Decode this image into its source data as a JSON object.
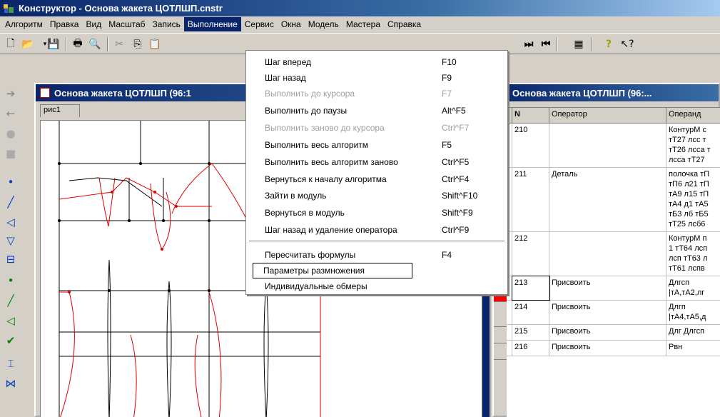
{
  "window": {
    "title": "Конструктор - Основа жакета ЦОТЛШП.cnstr"
  },
  "menubar": {
    "items": [
      "Алгоритм",
      "Правка",
      "Вид",
      "Масштаб",
      "Запись",
      "Выполнение",
      "Сервис",
      "Окна",
      "Модель",
      "Мастера",
      "Справка"
    ],
    "active_index": 5
  },
  "dropdown": {
    "items": [
      {
        "label": "Шаг вперед",
        "shortcut": "F10",
        "enabled": true
      },
      {
        "label": "Шаг назад",
        "shortcut": "F9",
        "enabled": true
      },
      {
        "label": "Выполнить до курсора",
        "shortcut": "F7",
        "enabled": false
      },
      {
        "label": "Выполнить до паузы",
        "shortcut": "Alt^F5",
        "enabled": true
      },
      {
        "label": "Выполнить заново до курсора",
        "shortcut": "Ctrl^F7",
        "enabled": false
      },
      {
        "label": "Выполнить весь алгоритм",
        "shortcut": "F5",
        "enabled": true
      },
      {
        "label": "Выполнить весь алгоритм заново",
        "shortcut": "Ctrl^F5",
        "enabled": true
      },
      {
        "label": "Вернуться к началу алгоритма",
        "shortcut": "Ctrl^F4",
        "enabled": true
      },
      {
        "label": "Зайти в модуль",
        "shortcut": "Shift^F10",
        "enabled": true
      },
      {
        "label": "Вернуться в модуль",
        "shortcut": "Shift^F9",
        "enabled": true
      },
      {
        "label": "Шаг назад и удаление оператора",
        "shortcut": "Ctrl^F9",
        "enabled": true
      },
      {
        "label": "Пересчитать формулы",
        "shortcut": "F4",
        "enabled": true
      },
      {
        "label": "Параметры размножения",
        "shortcut": "",
        "enabled": true,
        "focused": true
      },
      {
        "label": "Индивидуальные обмеры",
        "shortcut": "",
        "enabled": true
      }
    ]
  },
  "drawing_window": {
    "title": "Основа жакета ЦОТЛШП (96:1",
    "tab": "рис1"
  },
  "algorithm_window": {
    "title": "Основа жакета ЦОТЛШП (96:...",
    "columns": [
      "N",
      "Оператор",
      "Операнд"
    ],
    "rows": [
      {
        "n": "210",
        "op": "",
        "operand": [
          "КонтурМ с",
          "тТ27 лсс т",
          "тТ26 лсса т",
          "лсса тТ27"
        ]
      },
      {
        "n": "211",
        "op": "Деталь",
        "operand": [
          "полочка тП",
          "тП6 л21 тП",
          "тА9 л15 тП",
          "тА4 д1 тА5",
          "тБ3 лб тБ5",
          "тТ25 лсб6"
        ]
      },
      {
        "n": "212",
        "op": "",
        "operand": [
          "КонтурМ п",
          "1 тТ64 лсп",
          "лсп тТ63 л",
          "тТ61 лспв"
        ]
      },
      {
        "n": "213",
        "op": "Присвоить",
        "operand": [
          "Длгсп",
          "|тА,тА2,лг"
        ],
        "current": true
      },
      {
        "n": "214",
        "op": "Присвоить",
        "operand": [
          "Длгп",
          "|тА4,тА5,д"
        ]
      },
      {
        "n": "215",
        "op": "Присвоить",
        "operand": [
          "Длг Длгсп"
        ]
      },
      {
        "n": "216",
        "op": "Присвоить",
        "operand": [
          "Рвн"
        ]
      }
    ]
  },
  "colors": {
    "titlebar": "#0a246a",
    "highlight": "#0a246a",
    "current_row_marker": "#ff0000",
    "pattern_red": "#e00000"
  }
}
